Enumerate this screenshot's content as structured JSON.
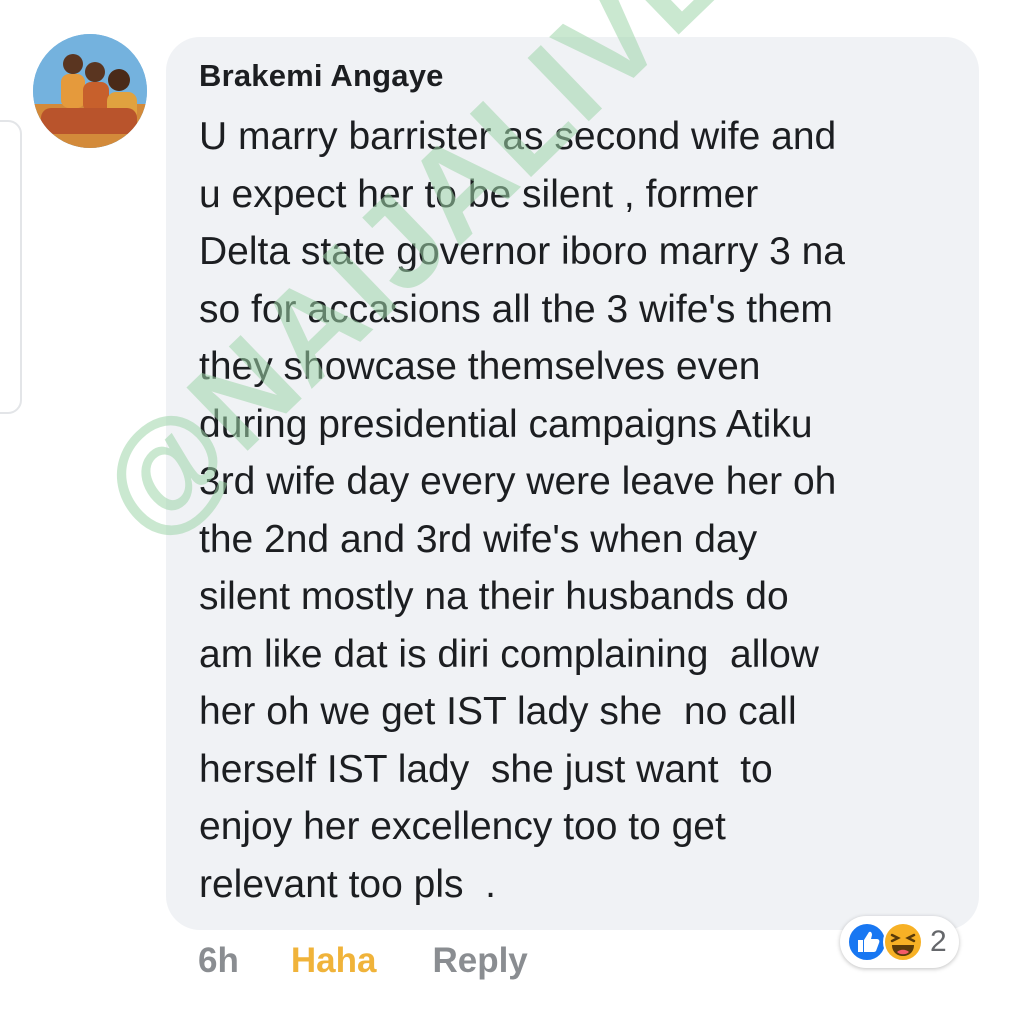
{
  "comment": {
    "author": "Brakemi Angaye",
    "lines": [
      "U marry barrister as second wife and",
      "u expect her to be silent , former",
      "Delta state governor iboro marry 3 na",
      "so for accasions all the 3 wife's them",
      "they showcase themselves even",
      "during presidential campaigns Atiku",
      "3rd wife day every were leave her oh",
      "the 2nd and 3rd wife's when day",
      "silent mostly na their husbands do",
      "am like dat is diri complaining  allow",
      "her oh we get IST lady she  no call",
      "herself IST lady  she just want  to",
      "enjoy her excellency too to get",
      "relevant too pls  ."
    ],
    "timestamp": "6h",
    "reaction_label": "Haha",
    "reply_label": "Reply",
    "reactions": {
      "icons": [
        "like-icon",
        "haha-icon"
      ],
      "count": "2"
    }
  },
  "watermark": "@NAIJALIVETV",
  "colors": {
    "bubble": "#f0f2f5",
    "text": "#1c1e21",
    "meta": "#8a8d91",
    "haha": "#f0b33a",
    "like_blue": "#1877f2",
    "watermark": "#9ed6aa"
  }
}
